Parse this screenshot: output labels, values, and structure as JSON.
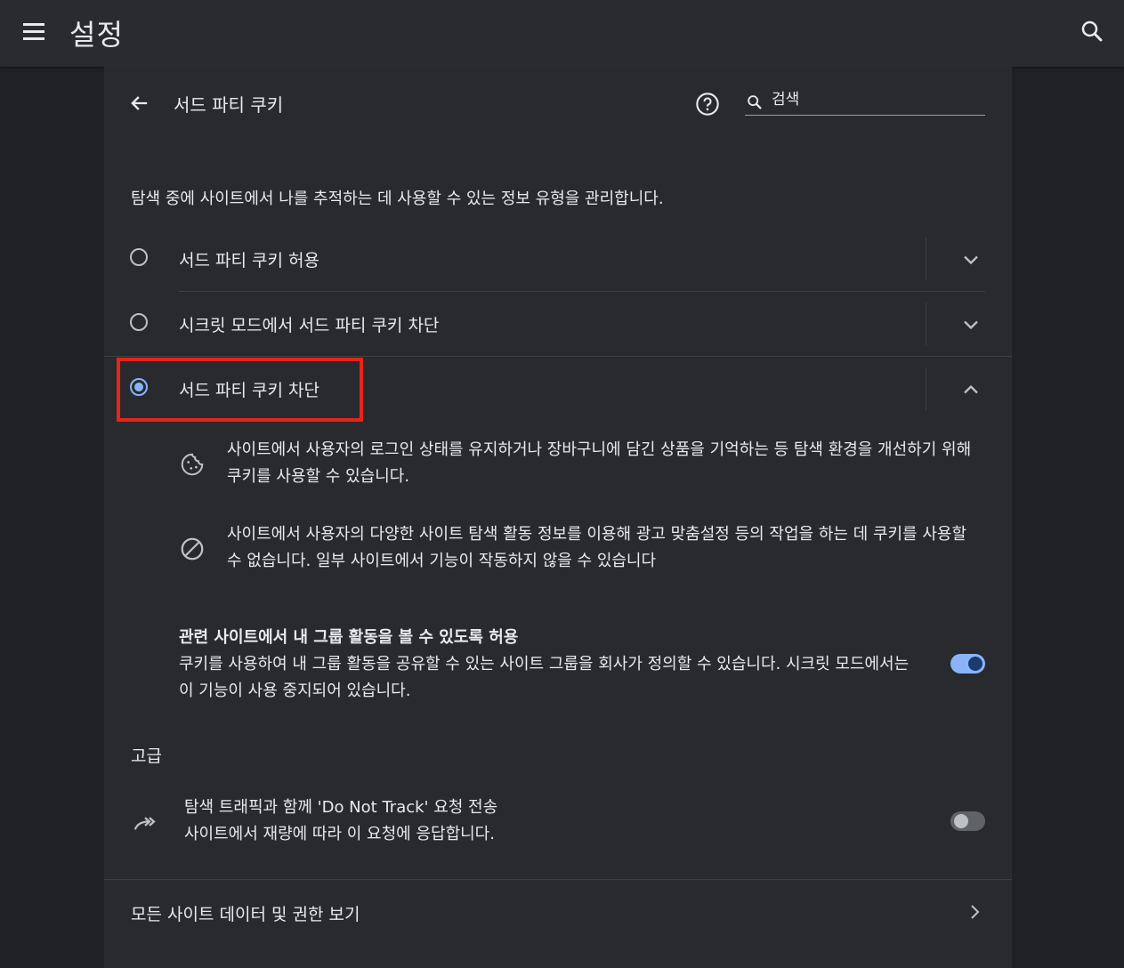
{
  "app": {
    "title": "설정"
  },
  "page": {
    "title": "서드 파티 쿠키",
    "search_placeholder": "검색",
    "description": "탐색 중에 사이트에서 나를 추적하는 데 사용할 수 있는 정보 유형을 관리합니다."
  },
  "options": [
    {
      "label": "서드 파티 쿠키 허용",
      "selected": false,
      "expanded": false
    },
    {
      "label": "시크릿 모드에서 서드 파티 쿠키 차단",
      "selected": false,
      "expanded": false
    },
    {
      "label": "서드 파티 쿠키 차단",
      "selected": true,
      "expanded": true
    }
  ],
  "block_details": [
    {
      "icon": "cookie-icon",
      "text": "사이트에서 사용자의 로그인 상태를 유지하거나 장바구니에 담긴 상품을 기억하는 등 탐색 환경을 개선하기 위해 쿠키를 사용할 수 있습니다."
    },
    {
      "icon": "block-icon",
      "text": "사이트에서 사용자의 다양한 사이트 탐색 활동 정보를 이용해 광고 맞춤설정 등의 작업을 하는 데 쿠키를 사용할 수 없습니다. 일부 사이트에서 기능이 작동하지 않을 수 있습니다"
    }
  ],
  "related_sites": {
    "title": "관련 사이트에서 내 그룹 활동을 볼 수 있도록 허용",
    "description": "쿠키를 사용하여 내 그룹 활동을 공유할 수 있는 사이트 그룹을 회사가 정의할 수 있습니다. 시크릿 모드에서는 이 기능이 사용 중지되어 있습니다.",
    "enabled": true
  },
  "advanced": {
    "label": "고급",
    "dnt_title": "탐색 트래픽과 함께 'Do Not Track' 요청 전송",
    "dnt_description": "사이트에서 재량에 따라 이 요청에 응답합니다.",
    "dnt_enabled": false
  },
  "all_sites": {
    "label": "모든 사이트 데이터 및 권한 보기"
  },
  "colors": {
    "background": "#202124",
    "card": "#292a2d",
    "accent": "#8ab4f8",
    "highlight": "#e8231b"
  }
}
